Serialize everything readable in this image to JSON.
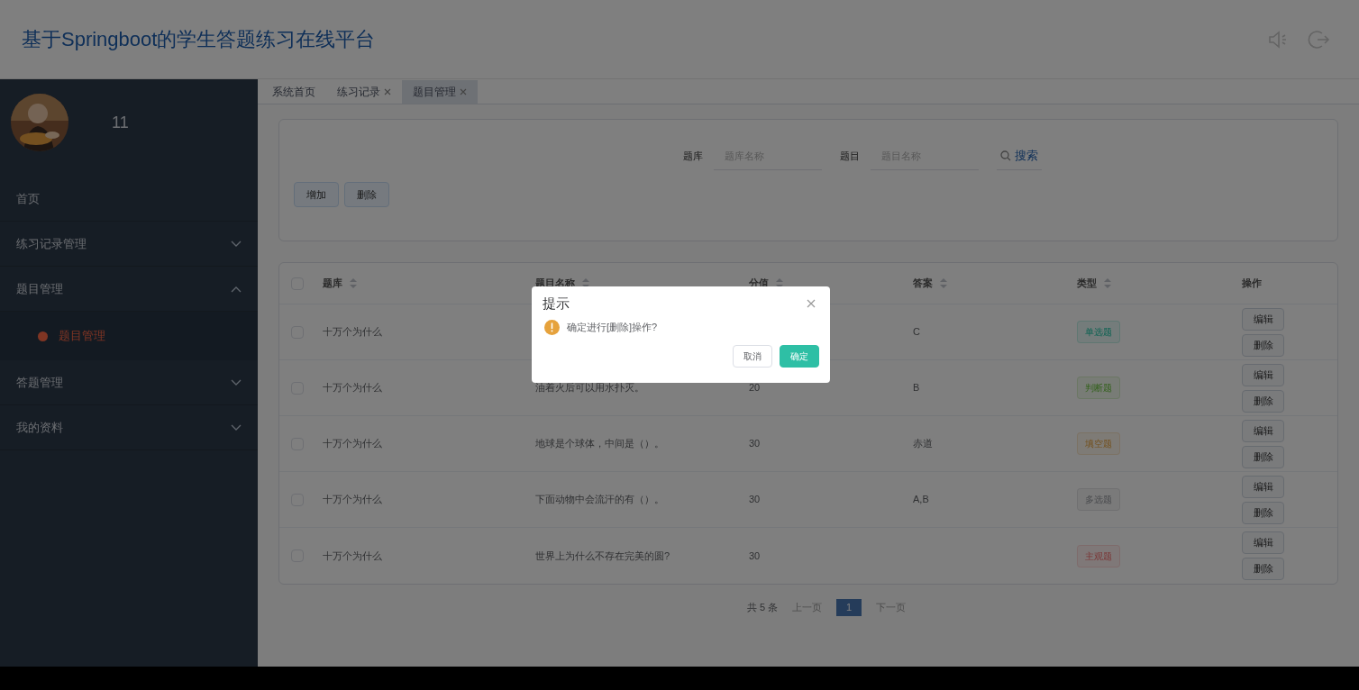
{
  "header": {
    "title": "基于Springboot的学生答题练习在线平台"
  },
  "sidebar": {
    "user": {
      "name": "11"
    },
    "items": [
      {
        "label": "首页",
        "kind": "link"
      },
      {
        "label": "练习记录管理",
        "kind": "group",
        "expanded": false
      },
      {
        "label": "题目管理",
        "kind": "group",
        "expanded": true,
        "children": [
          {
            "label": "题目管理",
            "selected": true
          }
        ]
      },
      {
        "label": "答题管理",
        "kind": "group",
        "expanded": false
      },
      {
        "label": "我的资料",
        "kind": "group",
        "expanded": false
      }
    ]
  },
  "tabs": [
    {
      "label": "系统首页",
      "closable": false,
      "selected": false
    },
    {
      "label": "练习记录",
      "closable": true,
      "selected": false
    },
    {
      "label": "题目管理",
      "closable": true,
      "selected": true
    }
  ],
  "search": {
    "fields": [
      {
        "label": "题库",
        "placeholder": "题库名称"
      },
      {
        "label": "题目",
        "placeholder": "题目名称"
      }
    ],
    "button": "搜索"
  },
  "actions": [
    "增加",
    "删除"
  ],
  "table": {
    "all_checked": false,
    "columns": [
      {
        "label": "题库",
        "sortable": true
      },
      {
        "label": "题目名称",
        "sortable": true
      },
      {
        "label": "分值",
        "sortable": true
      },
      {
        "label": "答案",
        "sortable": true
      },
      {
        "label": "类型",
        "sortable": true
      },
      {
        "label": "操作",
        "sortable": false
      }
    ],
    "rows": [
      {
        "checked": false,
        "bank": "十万个为什么",
        "answer": "C",
        "type": {
          "label": "单选题",
          "kind": "single"
        },
        "buttons": [
          "编辑",
          "删除"
        ]
      },
      {
        "checked": false,
        "bank": "十万个为什么",
        "title": "油着火后可以用水扑灭。",
        "score": "20",
        "answer": "B",
        "type": {
          "label": "判断题",
          "kind": "judge"
        },
        "buttons": [
          "编辑",
          "删除"
        ]
      },
      {
        "checked": false,
        "bank": "十万个为什么",
        "title": "地球是个球体，中间是（）。",
        "score": "30",
        "answer": "赤道",
        "type": {
          "label": "填空题",
          "kind": "blank"
        },
        "buttons": [
          "编辑",
          "删除"
        ]
      },
      {
        "checked": false,
        "bank": "十万个为什么",
        "title": "下面动物中会流汗的有（）。",
        "score": "30",
        "answer": "A,B",
        "type": {
          "label": "多选题",
          "kind": "multi"
        },
        "buttons": [
          "编辑",
          "删除"
        ]
      },
      {
        "checked": false,
        "bank": "十万个为什么",
        "title": "世界上为什么不存在完美的圆?",
        "score": "30",
        "type": {
          "label": "主观题",
          "kind": "subjective"
        },
        "buttons": [
          "编辑",
          "删除"
        ]
      }
    ]
  },
  "pagination": {
    "total": "共 5 条",
    "prev": "上一页",
    "pages": [
      {
        "label": "1",
        "selected": true
      }
    ],
    "next": "下一页"
  },
  "dialog": {
    "title": "提示",
    "message": "确定进行[删除]操作?",
    "buttons": [
      "取消",
      "确定"
    ]
  }
}
